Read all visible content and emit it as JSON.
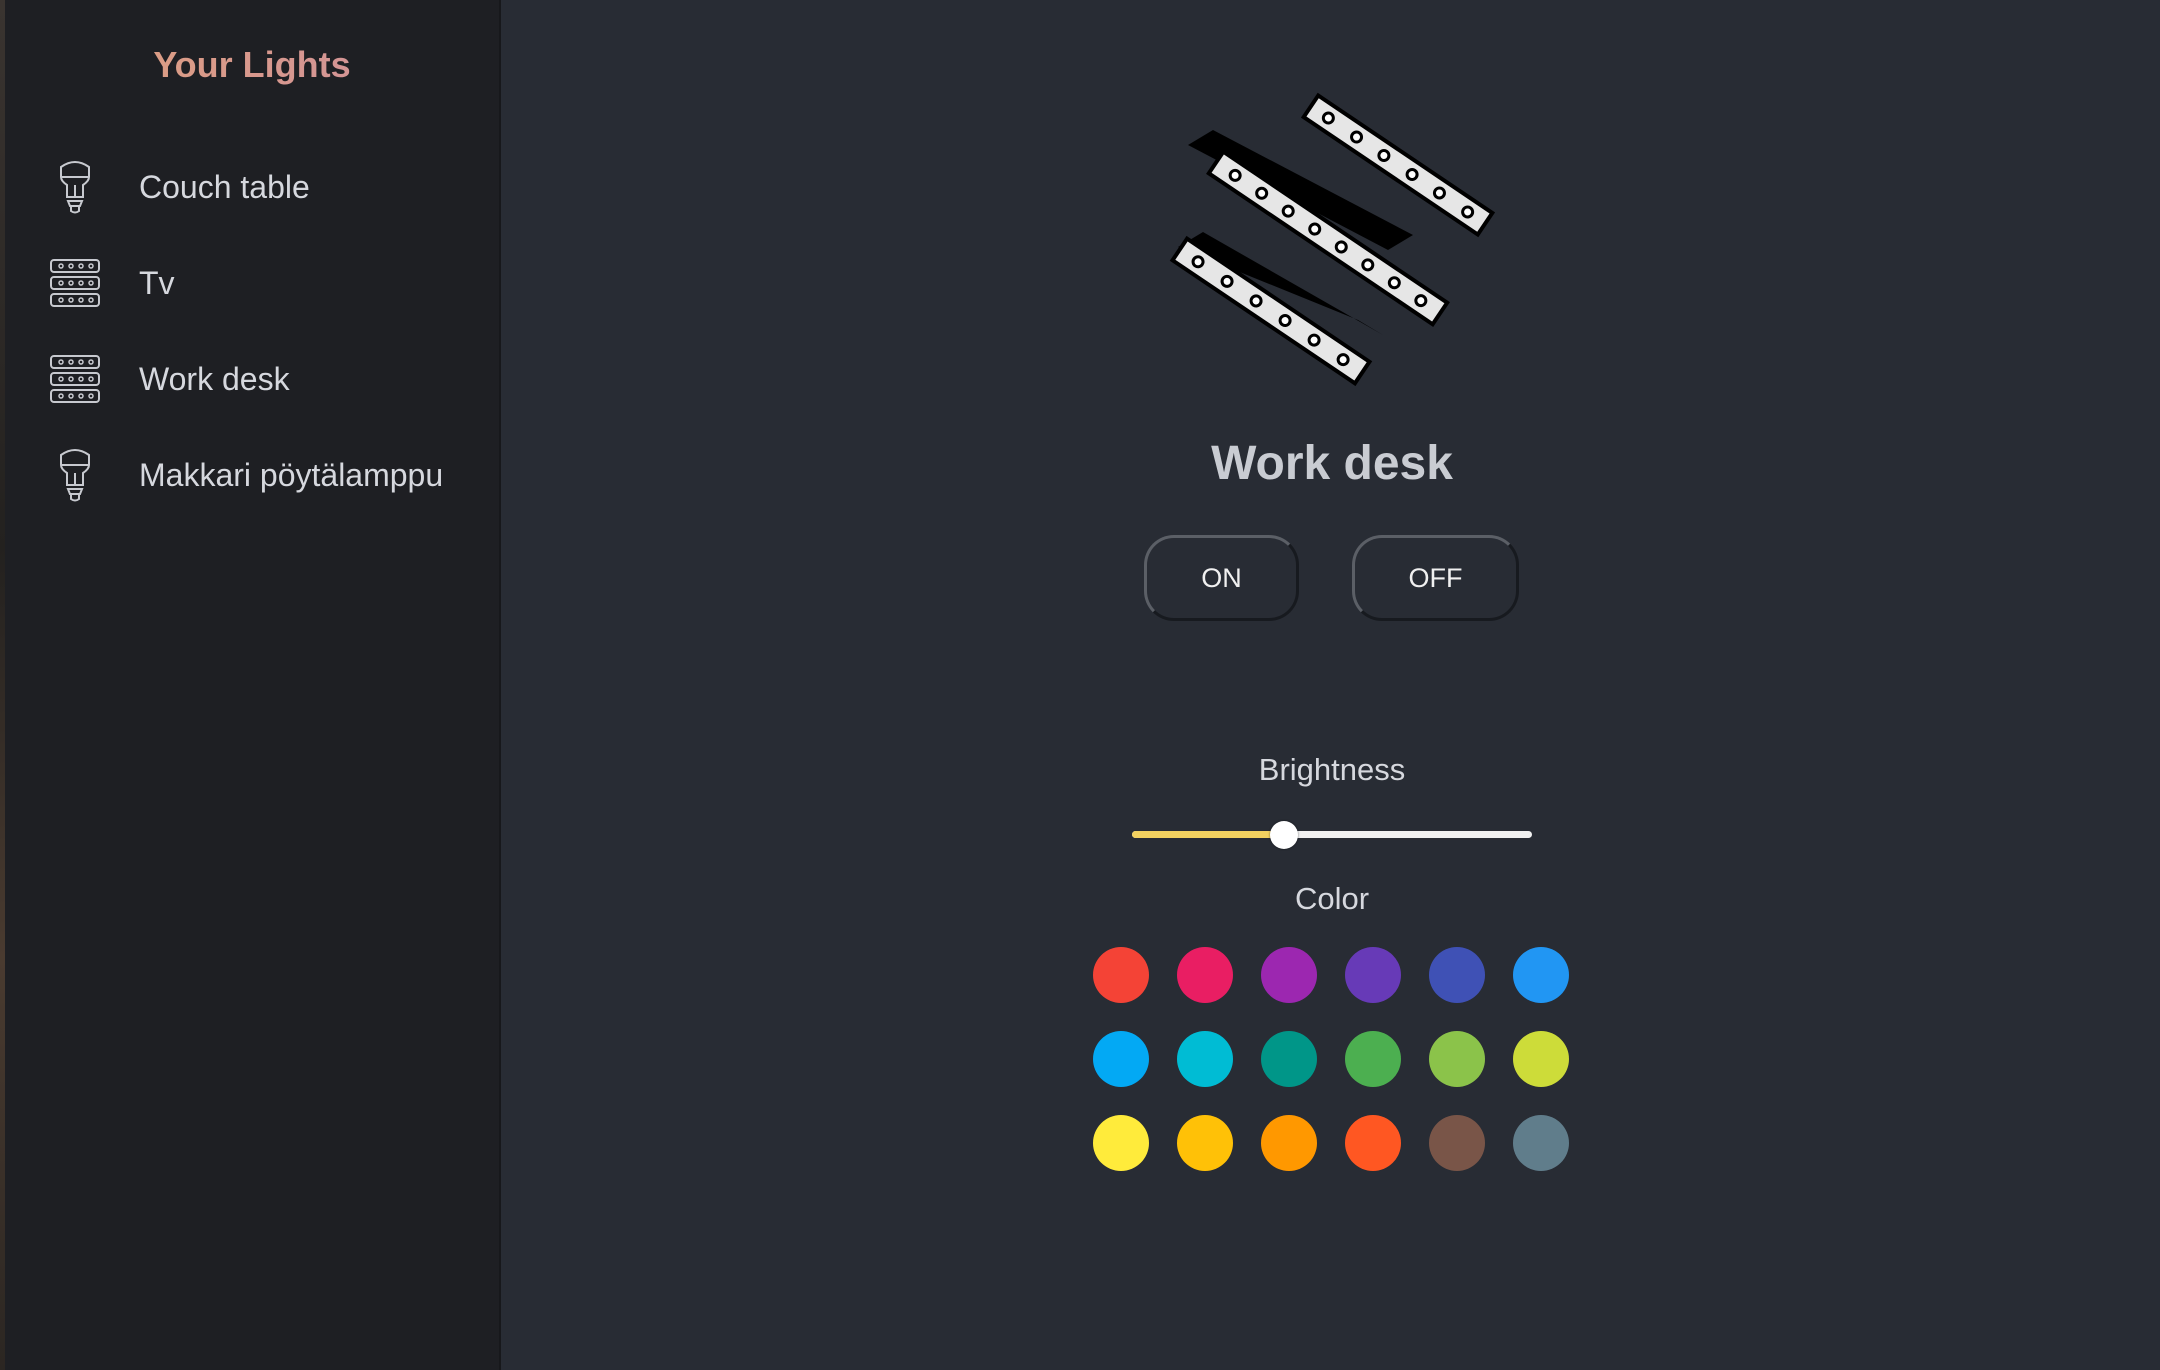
{
  "sidebar": {
    "title": "Your Lights",
    "items": [
      {
        "label": "Couch table",
        "icon": "bulb-icon"
      },
      {
        "label": "Tv",
        "icon": "lightstrip-icon"
      },
      {
        "label": "Work desk",
        "icon": "lightstrip-icon"
      },
      {
        "label": "Makkari pöytälamppu",
        "icon": "bulb-icon"
      }
    ]
  },
  "device": {
    "name": "Work desk",
    "image": "lightstrip-illustration",
    "on_label": "ON",
    "off_label": "OFF"
  },
  "brightness": {
    "label": "Brightness",
    "value_percent": 38
  },
  "color": {
    "label": "Color",
    "swatches": [
      "#f44336",
      "#e91e63",
      "#9c27b0",
      "#673ab7",
      "#3f51b5",
      "#2196f3",
      "#03a9f4",
      "#00bcd4",
      "#009688",
      "#4caf50",
      "#8bc34a",
      "#cddc39",
      "#ffeb3b",
      "#ffc107",
      "#ff9800",
      "#ff5722",
      "#795548",
      "#607d8b"
    ]
  },
  "theme": {
    "background": "#282c34",
    "sidebar_background": "#1e1f23",
    "accent": "#f3d260"
  }
}
